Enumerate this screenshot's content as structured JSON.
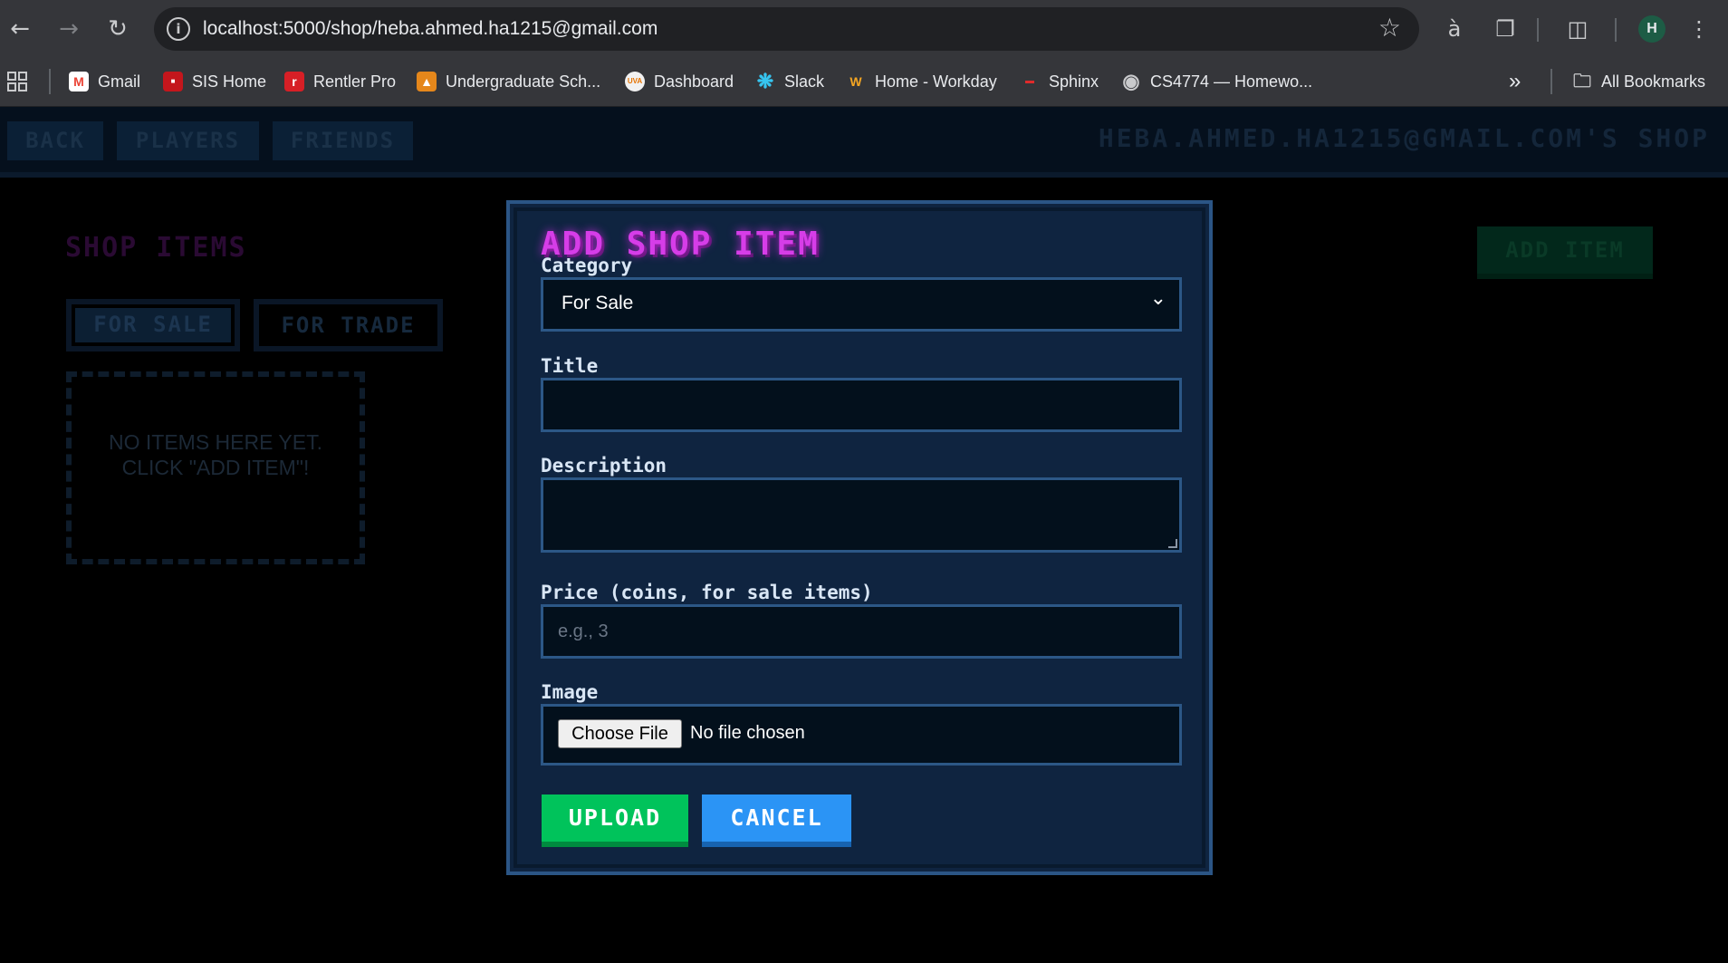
{
  "browser": {
    "url": "localhost:5000/shop/heba.ahmed.ha1215@gmail.com",
    "profile_initial": "H",
    "bookmarks": [
      {
        "label": "Gmail",
        "icon": "gmail-icon",
        "color": "#ea4335"
      },
      {
        "label": "SIS Home",
        "icon": "sis-icon",
        "color": "#c4161c"
      },
      {
        "label": "Rentler Pro",
        "icon": "rentler-icon",
        "color": "#d71f26"
      },
      {
        "label": "Undergraduate Sch...",
        "icon": "school-icon",
        "color": "#e5871b"
      },
      {
        "label": "Dashboard",
        "icon": "uva-icon",
        "color": "#f1f1f1"
      },
      {
        "label": "Slack",
        "icon": "slack-icon",
        "color": "#36c5f0"
      },
      {
        "label": "Home - Workday",
        "icon": "workday-icon",
        "color": "#f5a623"
      },
      {
        "label": "Sphinx",
        "icon": "sphinx-icon",
        "color": "#e02b2b"
      },
      {
        "label": "CS4774 — Homewo...",
        "icon": "globe-icon",
        "color": "#c9cacc"
      }
    ],
    "all_bookmarks": "All Bookmarks"
  },
  "header": {
    "back": "BACK",
    "players": "PLAYERS",
    "friends": "FRIENDS",
    "title": "HEBA.AHMED.HA1215@GMAIL.COM'S SHOP"
  },
  "shop": {
    "title": "SHOP ITEMS",
    "tab_sale": "FOR SALE",
    "tab_trade": "FOR TRADE",
    "empty_message": "NO ITEMS HERE YET. CLICK \"ADD ITEM\"!",
    "add_item": "ADD ITEM"
  },
  "modal": {
    "title": "ADD SHOP ITEM",
    "category_label": "Category",
    "category_value": "For Sale",
    "title_label": "Title",
    "title_value": "",
    "description_label": "Description",
    "description_value": "",
    "price_label": "Price (coins, for sale items)",
    "price_placeholder": "e.g., 3",
    "image_label": "Image",
    "choose_file": "Choose File",
    "no_file": "No file chosen",
    "upload": "UPLOAD",
    "cancel": "CANCEL"
  }
}
